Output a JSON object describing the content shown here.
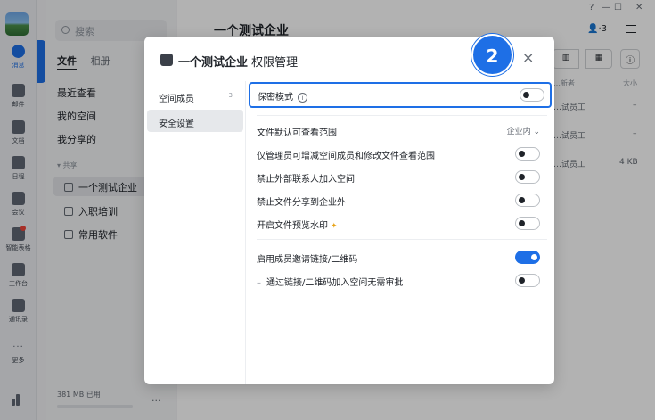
{
  "rail": {
    "items": [
      {
        "label": "消息",
        "icon": "chat-icon",
        "active": true
      },
      {
        "label": "邮件",
        "icon": "mail-icon"
      },
      {
        "label": "文档",
        "icon": "doc-icon"
      },
      {
        "label": "日程",
        "icon": "calendar-icon"
      },
      {
        "label": "会议",
        "icon": "meeting-icon"
      },
      {
        "label": "智能表格",
        "icon": "smart-sheet-icon",
        "badge": true
      },
      {
        "label": "工作台",
        "icon": "workbench-icon"
      },
      {
        "label": "通讯录",
        "icon": "contacts-icon"
      },
      {
        "label": "更多",
        "icon": "more-icon"
      }
    ]
  },
  "panel": {
    "search_placeholder": "搜索",
    "tabs": [
      "文件",
      "相册"
    ],
    "nav": [
      "最近查看",
      "我的空间",
      "我分享的"
    ],
    "section_label": "▾ 共享",
    "spaces": [
      "一个测试企业",
      "入职培训",
      "常用软件"
    ],
    "storage": "381 MB 已用",
    "more": "···"
  },
  "main": {
    "title": "一个测试企业",
    "members": "3",
    "window_controls": [
      "?",
      "—",
      "☐",
      "✕"
    ],
    "columns": [
      "…新者",
      "大小"
    ],
    "rows": [
      {
        "owner": "…试员工",
        "size": "–"
      },
      {
        "owner": "…试员工",
        "size": "–"
      },
      {
        "owner": "…试员工",
        "size": "4 KB"
      }
    ]
  },
  "modal": {
    "title_bold": "一个测试企业",
    "title_rest": " 权限管理",
    "step_badge": "2",
    "close": "×",
    "nav": [
      {
        "label": "空间成员",
        "count": "3"
      },
      {
        "label": "安全设置",
        "selected": true
      }
    ],
    "settings": {
      "secret_mode": {
        "label": "保密模式",
        "on": false
      },
      "default_scope": {
        "label": "文件默认可查看范围",
        "value": "企业内"
      },
      "admin_only": {
        "label": "仅管理员可增减空间成员和修改文件查看范围",
        "on": false
      },
      "no_external": {
        "label": "禁止外部联系人加入空间",
        "on": false
      },
      "no_share_out": {
        "label": "禁止文件分享到企业外",
        "on": false
      },
      "watermark": {
        "label": "开启文件预览水印",
        "on": false
      },
      "invite_link": {
        "label": "启用成员邀请链接/二维码",
        "on": true
      },
      "no_approval": {
        "label": "通过链接/二维码加入空间无需审批",
        "on": false
      }
    }
  },
  "colors": {
    "accent": "#1e6fe6",
    "overlay": "rgba(0,0,0,0.30)"
  }
}
